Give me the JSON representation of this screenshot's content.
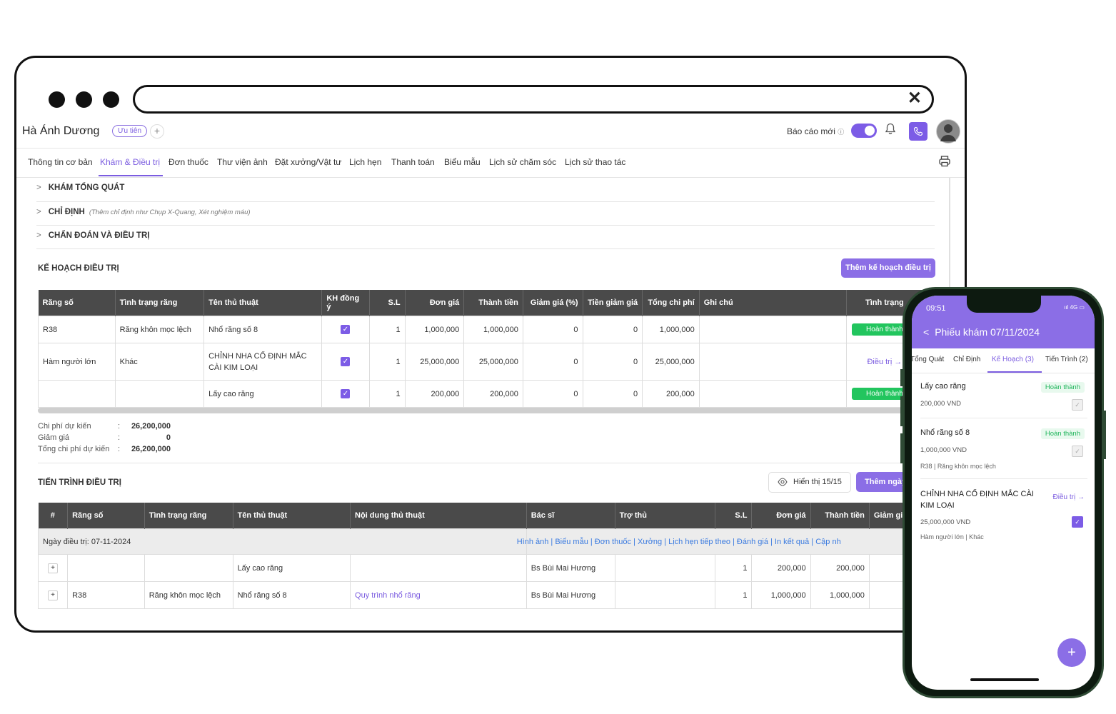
{
  "header": {
    "patient_name": "Hà Ánh Dương",
    "priority_badge": "Ưu tiên",
    "add": "+",
    "report_label": "Báo cáo mới",
    "info": "ⓘ"
  },
  "tabs": [
    "Thông tin cơ bản",
    "Khám & Điều trị",
    "Đơn thuốc",
    "Thư viện ảnh",
    "Đặt xưởng/Vật tư",
    "Lịch hẹn",
    "Thanh toán",
    "Biểu mẫu",
    "Lịch sử chăm sóc",
    "Lịch sử thao tác"
  ],
  "sections": {
    "general": "KHÁM TỔNG QUÁT",
    "indication": "CHỈ ĐỊNH",
    "indication_hint": "(Thêm chỉ định như Chụp X-Quang, Xét nghiệm máu)",
    "diagnosis": "CHẨN ĐOÁN VÀ ĐIỀU TRỊ"
  },
  "plan": {
    "title": "KẾ HOẠCH ĐIỀU TRỊ",
    "add_button": "Thêm kế hoạch điều trị",
    "columns": [
      "Răng số",
      "Tình trạng răng",
      "Tên thủ thuật",
      "KH đồng ý",
      "S.L",
      "Đơn giá",
      "Thành tiền",
      "Giảm giá (%)",
      "Tiền giảm giá",
      "Tổng chi phí",
      "Ghi chú",
      "Tình trạng"
    ],
    "rows": [
      {
        "tooth": "R38",
        "condition": "Răng khôn mọc lệch",
        "procedure": "Nhổ răng số 8",
        "qty": "1",
        "price": "1,000,000",
        "amount": "1,000,000",
        "discount_pct": "0",
        "discount": "0",
        "total": "1,000,000",
        "note": "",
        "status": "Hoàn thành"
      },
      {
        "tooth": "Hàm người lớn",
        "condition": "Khác",
        "procedure": "CHỈNH NHA CỐ ĐỊNH MẮC CÀI KIM LOẠI",
        "qty": "1",
        "price": "25,000,000",
        "amount": "25,000,000",
        "discount_pct": "0",
        "discount": "0",
        "total": "25,000,000",
        "note": "",
        "status": "Điều trị →"
      },
      {
        "tooth": "",
        "condition": "",
        "procedure": "Lấy cao răng",
        "qty": "1",
        "price": "200,000",
        "amount": "200,000",
        "discount_pct": "0",
        "discount": "0",
        "total": "200,000",
        "note": "",
        "status": "Hoàn thành"
      }
    ],
    "summary": [
      {
        "label": "Chi phí dự kiến",
        "value": "26,200,000"
      },
      {
        "label": "Giảm giá",
        "value": "0"
      },
      {
        "label": "Tổng chi phí dự kiến",
        "value": "26,200,000"
      }
    ]
  },
  "progress": {
    "title": "TIẾN TRÌNH ĐIỀU TRỊ",
    "show_button": "Hiển thị 15/15",
    "add_button": "Thêm ngày",
    "columns": [
      "#",
      "Răng số",
      "Tình trạng răng",
      "Tên thủ thuật",
      "Nội dung thủ thuật",
      "Bác sĩ",
      "Trợ thủ",
      "S.L",
      "Đơn giá",
      "Thành tiền",
      "Giảm giá"
    ],
    "day_label": "Ngày điều trị: 07-11-2024",
    "day_links": "Hình ảnh | Biểu mẫu | Đơn thuốc | Xưởng | Lịch hẹn tiếp theo | Đánh giá | In kết quả | Cập nh",
    "rows": [
      {
        "tooth": "",
        "condition": "",
        "procedure": "Lấy cao răng",
        "content": "",
        "doctor": "Bs Bùi Mai Hương",
        "assistant": "",
        "qty": "1",
        "price": "200,000",
        "amount": "200,000"
      },
      {
        "tooth": "R38",
        "condition": "Răng khôn mọc lệch",
        "procedure": "Nhổ răng số 8",
        "content": "Quy trình nhổ răng",
        "doctor": "Bs Bùi Mai Hương",
        "assistant": "",
        "qty": "1",
        "price": "1,000,000",
        "amount": "1,000,000"
      }
    ]
  },
  "phone": {
    "time": "09:51",
    "signal": "ııl 4G ▭",
    "title": "Phiếu khám 07/11/2024",
    "tabs": [
      "Tổng Quát",
      "Chỉ Định",
      "Kế Hoạch (3)",
      "Tiến Trình (2)"
    ],
    "items": [
      {
        "name": "Lấy cao răng",
        "status": "Hoàn thành",
        "price": "200,000 VND",
        "sub": ""
      },
      {
        "name": "Nhổ răng số 8",
        "status": "Hoàn thành",
        "price": "1,000,000 VND",
        "sub": "R38   |   Răng khôn mọc lệch"
      },
      {
        "name": "CHỈNH NHA CỐ ĐỊNH MẮC CÀI KIM LOẠI",
        "status": "Điều trị →",
        "price": "25,000,000 VND",
        "sub": "Hàm người lớn   |   Khác"
      }
    ]
  },
  "colors": {
    "accent": "#7c5ce6",
    "success": "#22c55e",
    "table_header": "#4a4a4a"
  }
}
